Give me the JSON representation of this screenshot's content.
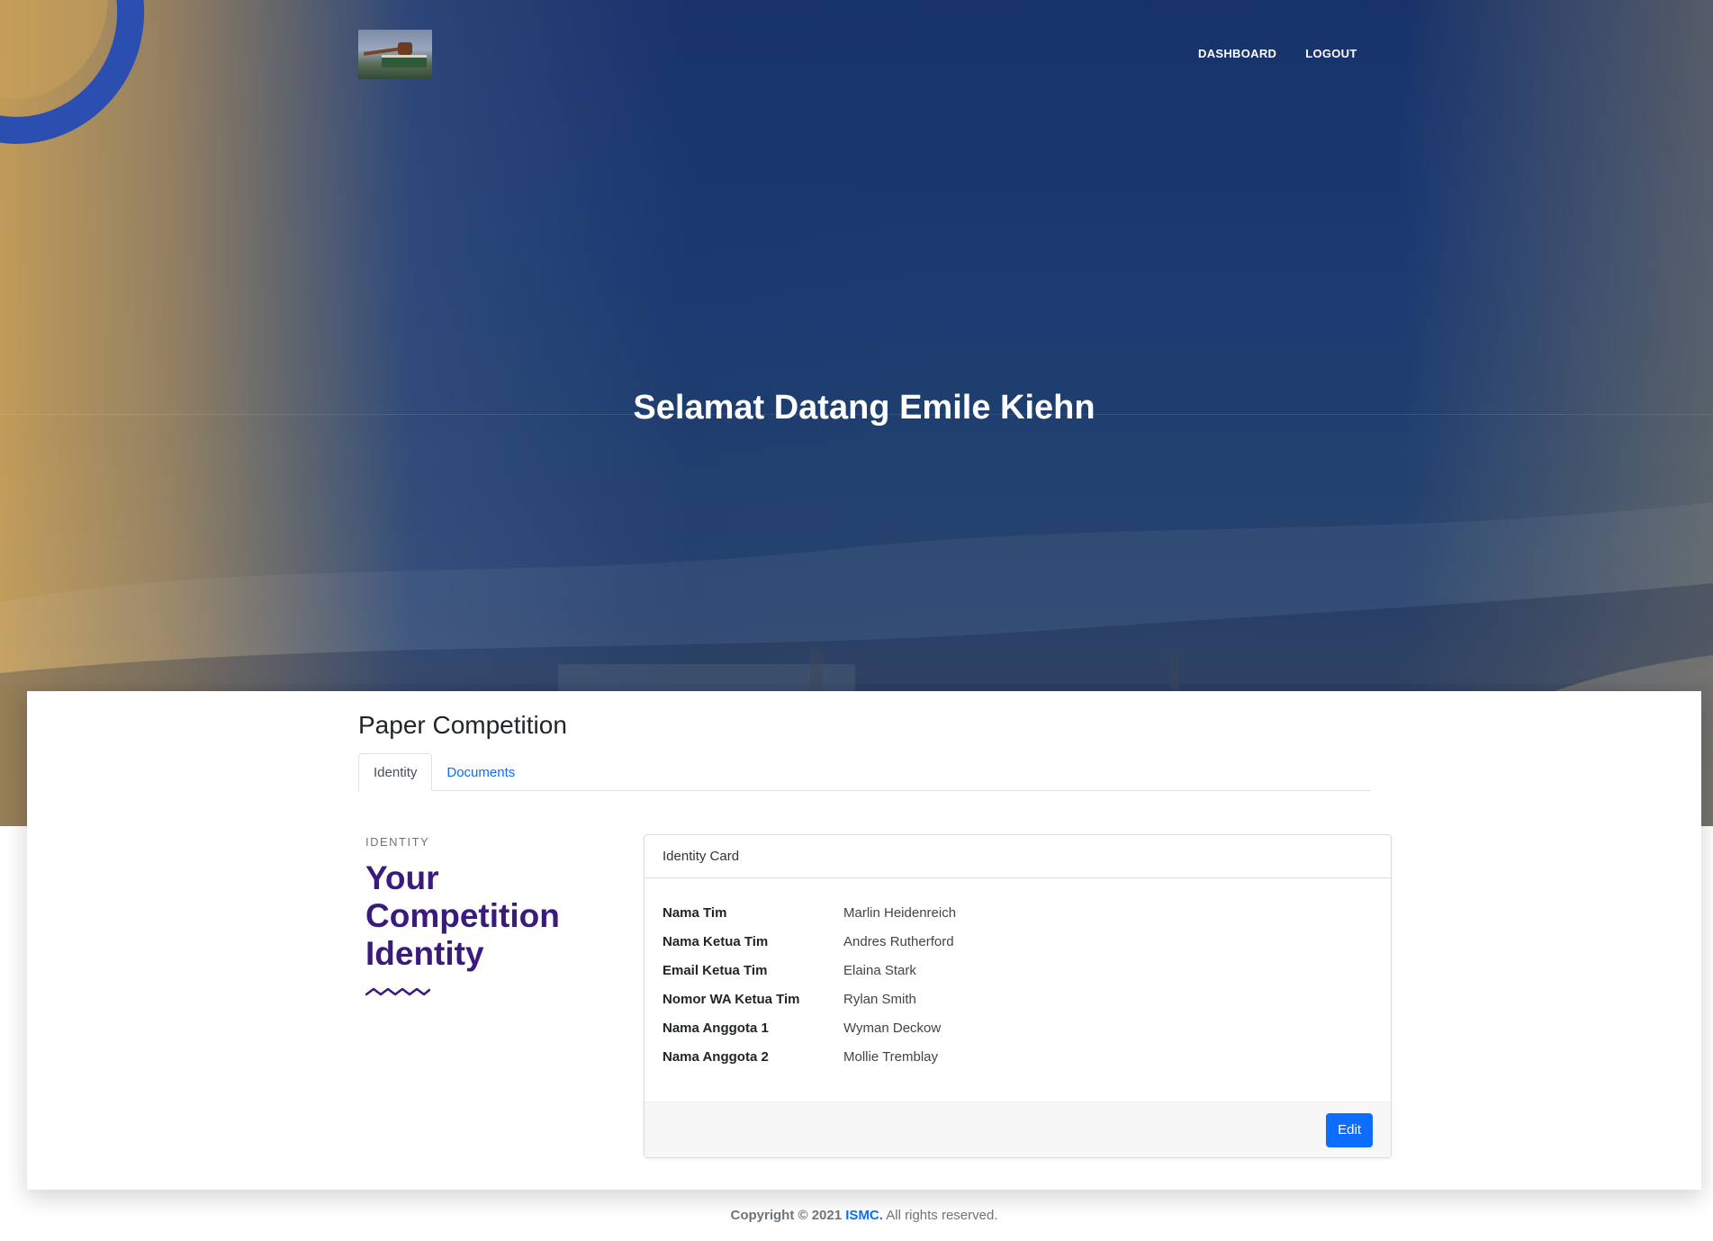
{
  "nav": {
    "dashboard_label": "DASHBOARD",
    "logout_label": "LOGOUT"
  },
  "hero": {
    "title": "Selamat Datang Emile Kiehn"
  },
  "section": {
    "title": "Paper Competition",
    "tabs": [
      {
        "label": "Identity",
        "active": true
      },
      {
        "label": "Documents",
        "active": false
      }
    ]
  },
  "identity": {
    "eyebrow": "IDENTITY",
    "heading_line1": "Your",
    "heading_line2": "Competition",
    "heading_line3": "Identity"
  },
  "card": {
    "header": "Identity Card",
    "rows": [
      {
        "label": "Nama Tim",
        "value": "Marlin Heidenreich"
      },
      {
        "label": "Nama Ketua Tim",
        "value": "Andres Rutherford"
      },
      {
        "label": "Email Ketua Tim",
        "value": "Elaina Stark"
      },
      {
        "label": "Nomor WA Ketua Tim",
        "value": "Rylan Smith"
      },
      {
        "label": "Nama Anggota 1",
        "value": "Wyman Deckow"
      },
      {
        "label": "Nama Anggota 2",
        "value": "Mollie Tremblay"
      }
    ],
    "edit_label": "Edit"
  },
  "footer": {
    "prefix": "Copyright © 2021",
    "brand": "ISMC.",
    "suffix": "All rights reserved."
  },
  "colors": {
    "accent": "#0d6efd",
    "heading_purple": "#3a1a7d",
    "hero_blue": "#1b3a72"
  },
  "icons": {
    "logo": "gavel-book-logo",
    "squiggle": "wave-divider-icon"
  }
}
